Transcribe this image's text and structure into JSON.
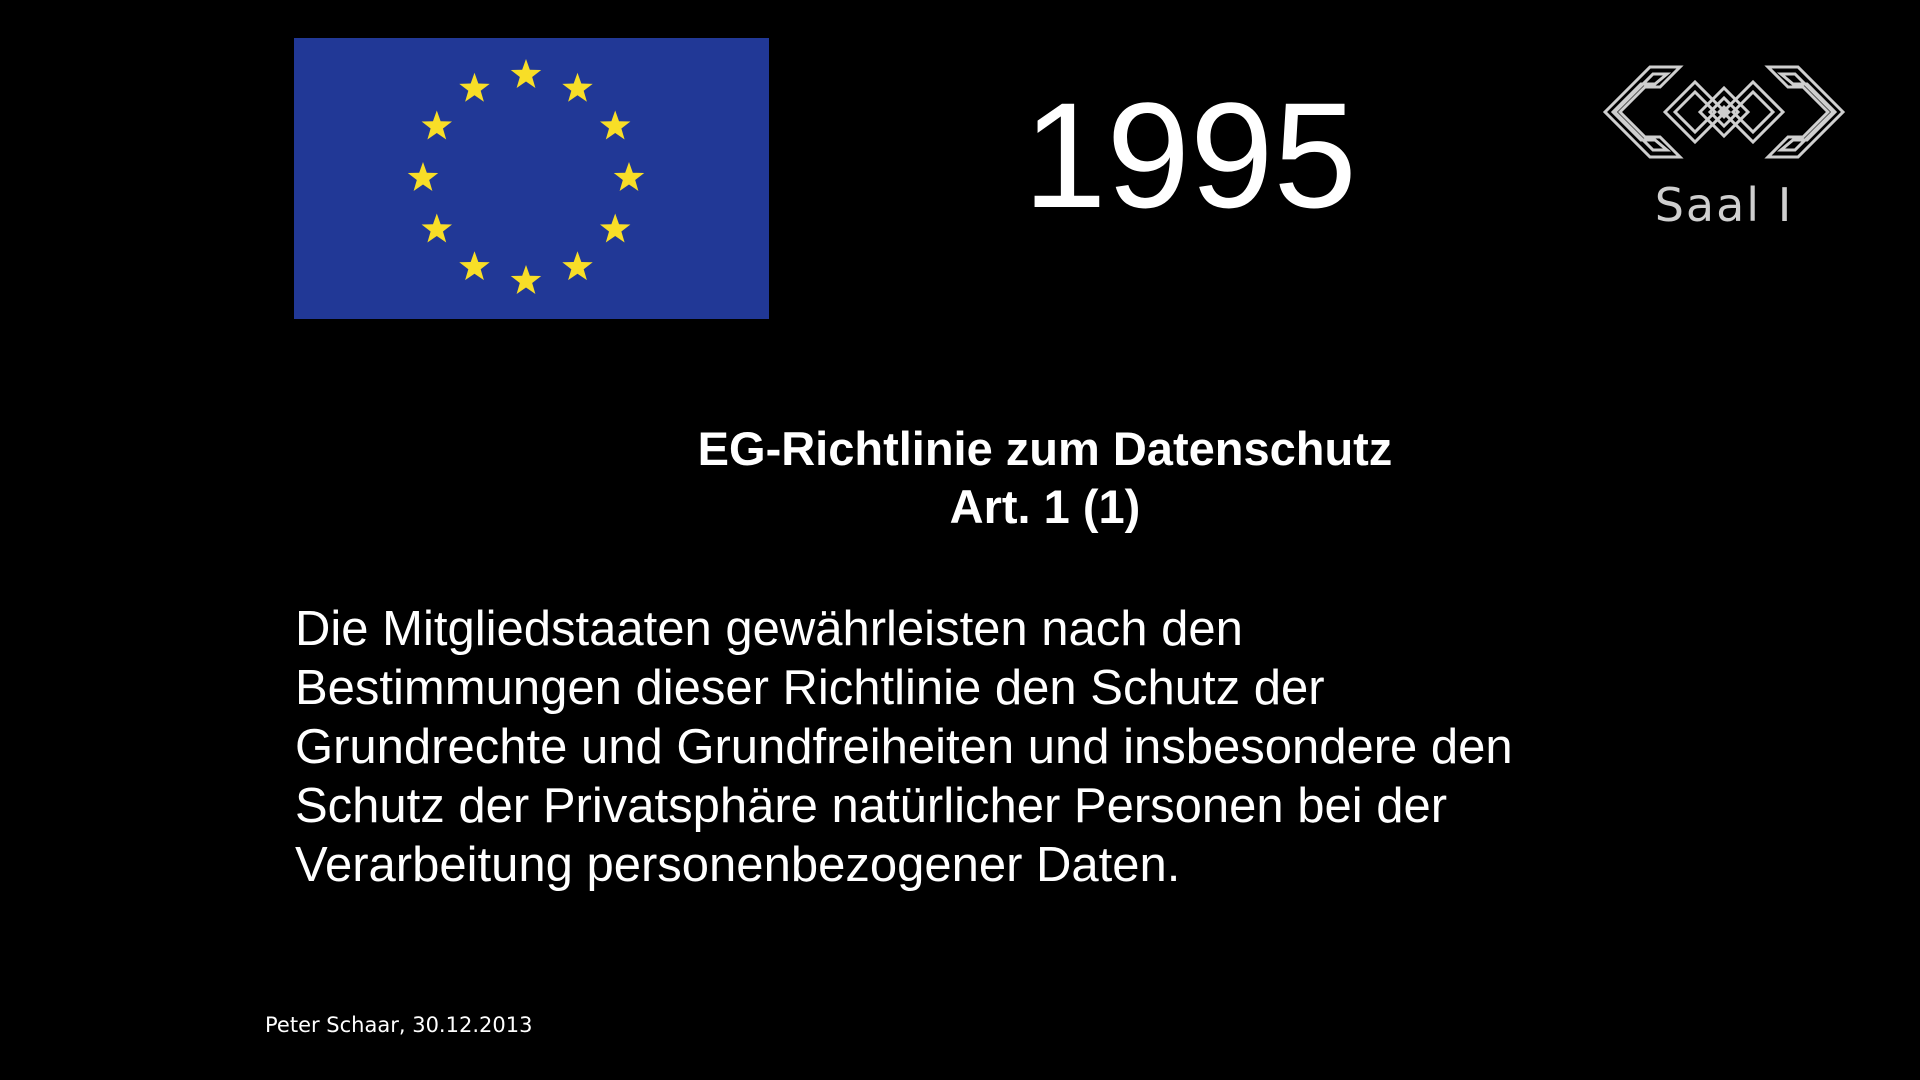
{
  "slide": {
    "year": "1995",
    "room_label": "Saal I",
    "heading": {
      "line1": "EG-Richtlinie zum Datenschutz",
      "line2": "Art. 1 (1)"
    },
    "body_lines": [
      "Die Mitgliedstaaten gewährleisten nach den",
      "Bestimmungen dieser Richtlinie den Schutz der",
      "Grundrechte und Grundfreiheiten und insbesondere den",
      "Schutz der Privatsphäre natürlicher Personen bei der",
      "Verarbeitung personenbezogener Daten."
    ],
    "footer": "Peter Schaar, 30.12.2013"
  },
  "icons": {
    "flag": "eu-flag-icon",
    "logo": "event-logo-icon"
  },
  "colors": {
    "background": "#000000",
    "text": "#ffffff",
    "flag_blue": "#213896",
    "flag_star": "#f8de27",
    "logo_gray": "#cfcfcf"
  }
}
